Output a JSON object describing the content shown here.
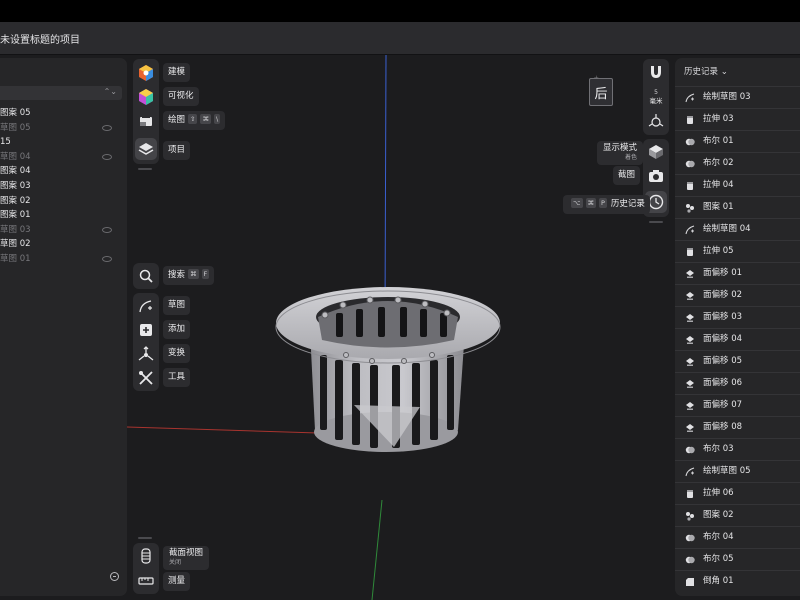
{
  "app": {
    "title": "未设置标题的项目"
  },
  "left_panel": {
    "items": [
      {
        "label": "图案 05",
        "dim": false,
        "eye": false
      },
      {
        "label": "草图 05",
        "dim": true,
        "eye": true
      },
      {
        "label": "15",
        "dim": false,
        "eye": false
      },
      {
        "label": "草图 04",
        "dim": true,
        "eye": true
      },
      {
        "label": "图案 04",
        "dim": false,
        "eye": false
      },
      {
        "label": "图案 03",
        "dim": false,
        "eye": false
      },
      {
        "label": "图案 02",
        "dim": false,
        "eye": false
      },
      {
        "label": "图案 01",
        "dim": false,
        "eye": false
      },
      {
        "label": "草图 03",
        "dim": true,
        "eye": true
      },
      {
        "label": "草图 02",
        "dim": false,
        "eye": false
      },
      {
        "label": "草图 01",
        "dim": true,
        "eye": true
      }
    ]
  },
  "toolbar_top": {
    "modeling": "建模",
    "visualize": "可视化",
    "drawing": "绘图",
    "drawing_shortcut": [
      "⇧",
      "⌘",
      "\\"
    ],
    "project": "项目"
  },
  "toolbar_mid": {
    "search": "搜索",
    "search_shortcut": [
      "⌘",
      "F"
    ],
    "sketch": "草图",
    "add": "添加",
    "transform": "变换",
    "tools": "工具"
  },
  "toolbar_bottom": {
    "section_view": "截面视图",
    "section_view_state": "关闭",
    "measure": "测量"
  },
  "right_toolbar": {
    "view_cube_face": "后",
    "view_cube_top": "ㅗ",
    "units_value": "5",
    "units_label": "毫米",
    "display_mode": "显示模式",
    "display_mode_value": "着色",
    "screenshot": "截图",
    "history": "历史记录",
    "history_shortcut": [
      "⌥",
      "⌘",
      "P"
    ]
  },
  "history_panel": {
    "header": "历史记录 ⌄",
    "items": [
      {
        "label": "绘制草图 03",
        "icon": "sketch-icon"
      },
      {
        "label": "拉伸 03",
        "icon": "extrude-icon"
      },
      {
        "label": "布尔 01",
        "icon": "boolean-icon"
      },
      {
        "label": "布尔 02",
        "icon": "boolean-icon"
      },
      {
        "label": "拉伸 04",
        "icon": "extrude-icon"
      },
      {
        "label": "图案 01",
        "icon": "pattern-icon"
      },
      {
        "label": "绘制草图 04",
        "icon": "sketch-icon"
      },
      {
        "label": "拉伸 05",
        "icon": "extrude-icon"
      },
      {
        "label": "面偏移 01",
        "icon": "face-offset-icon"
      },
      {
        "label": "面偏移 02",
        "icon": "face-offset-icon"
      },
      {
        "label": "面偏移 03",
        "icon": "face-offset-icon"
      },
      {
        "label": "面偏移 04",
        "icon": "face-offset-icon"
      },
      {
        "label": "面偏移 05",
        "icon": "face-offset-icon"
      },
      {
        "label": "面偏移 06",
        "icon": "face-offset-icon"
      },
      {
        "label": "面偏移 07",
        "icon": "face-offset-icon"
      },
      {
        "label": "面偏移 08",
        "icon": "face-offset-icon"
      },
      {
        "label": "布尔 03",
        "icon": "boolean-icon"
      },
      {
        "label": "绘制草图 05",
        "icon": "sketch-icon"
      },
      {
        "label": "拉伸 06",
        "icon": "extrude-icon"
      },
      {
        "label": "图案 02",
        "icon": "pattern-icon"
      },
      {
        "label": "布尔 04",
        "icon": "boolean-icon"
      },
      {
        "label": "布尔 05",
        "icon": "boolean-icon"
      },
      {
        "label": "倒角 01",
        "icon": "chamfer-icon"
      }
    ]
  }
}
